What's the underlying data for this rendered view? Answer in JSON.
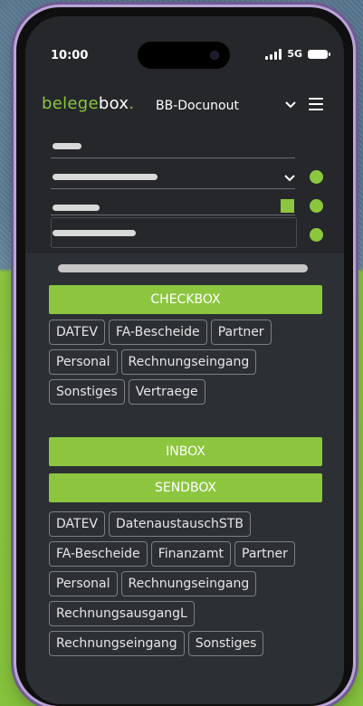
{
  "status": {
    "time": "10:00",
    "network": "5G"
  },
  "header": {
    "logo_part1": "belege",
    "logo_part2": "box",
    "logo_dot": ".",
    "workspace": "BB-Docunout"
  },
  "colors": {
    "accent": "#8cc63f",
    "panel": "#2c2f34",
    "screen": "#25272a"
  },
  "buttons": {
    "checkbox": "CHECKBOX",
    "inbox": "INBOX",
    "sendbox": "SENDBOX"
  },
  "checkbox_tags": [
    "DATEV",
    "FA-Bescheide",
    "Partner",
    "Personal",
    "Rechnungseingang",
    "Sonstiges",
    "Vertraege"
  ],
  "sendbox_tags": [
    "DATEV",
    "DatenaustauschSTB",
    "FA-Bescheide",
    "Finanzamt",
    "Partner",
    "Personal",
    "Rechnungseingang",
    "RechnungsausgangL",
    "Rechnungseingang",
    "Sonstiges"
  ]
}
